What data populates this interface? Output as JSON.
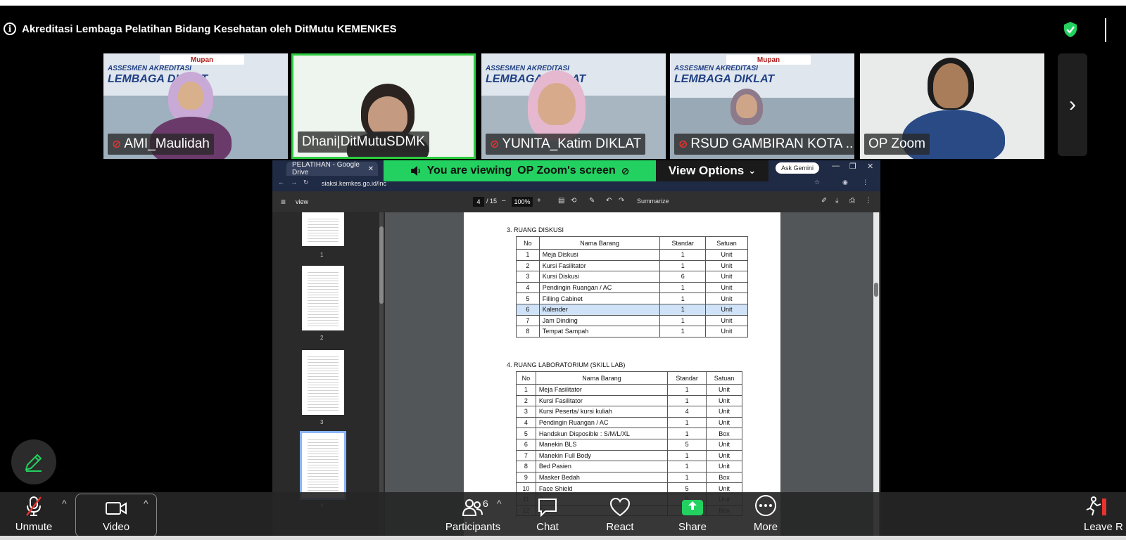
{
  "meeting": {
    "title": "Akreditasi Lembaga Pelatihan Bidang Kesehatan oleh DitMutu KEMENKES"
  },
  "participants_strip": [
    {
      "name": "AMI_Maulidah",
      "muted": true
    },
    {
      "name": "Dhani|DitMutuSDMK",
      "muted": false,
      "active": true
    },
    {
      "name": "YUNITA_Katim DIKLAT",
      "muted": true
    },
    {
      "name": "RSUD GAMBIRAN KOTA ...",
      "muted": true
    },
    {
      "name": "OP Zoom",
      "muted": false
    }
  ],
  "banner": {
    "line1": "ASSESMEN AKREDITASI",
    "line2": "LEMBAGA DIKLAT",
    "brand": "Mupan"
  },
  "share": {
    "viewing_prefix": "You are viewing",
    "viewing_name": "OP Zoom's screen",
    "view_options": "View Options"
  },
  "browser": {
    "tab_title": "PELATIHAN - Google Drive",
    "url": "siaksi.kemkes.go.id/inc",
    "ask_gemini": "Ask Gemini",
    "doc_label": "view",
    "page_current": "4",
    "page_total": "/ 15",
    "zoom": "100%",
    "summarize": "Summarize"
  },
  "thumbnails": [
    {
      "label": "1"
    },
    {
      "label": "2"
    },
    {
      "label": "3"
    },
    {
      "label": "4",
      "selected": true
    }
  ],
  "document": {
    "section3": {
      "title": "3.  RUANG DISKUSI",
      "headers": [
        "No",
        "Nama Barang",
        "Standar",
        "Satuan"
      ],
      "rows": [
        [
          "1",
          "Meja Diskusi",
          "1",
          "Unit"
        ],
        [
          "2",
          "Kursi Fasilitator",
          "1",
          "Unit"
        ],
        [
          "3",
          "Kursi Diskusi",
          "6",
          "Unit"
        ],
        [
          "4",
          "Pendingin Ruangan / AC",
          "1",
          "Unit"
        ],
        [
          "5",
          "Filling Cabinet",
          "1",
          "Unit"
        ],
        [
          "6",
          "Kalender",
          "1",
          "Unit"
        ],
        [
          "7",
          "Jam Dinding",
          "1",
          "Unit"
        ],
        [
          "8",
          "Tempat Sampah",
          "1",
          "Unit"
        ]
      ]
    },
    "section4": {
      "title": "4.  RUANG LABORATORIUM (SKILL LAB)",
      "headers": [
        "No",
        "Nama Barang",
        "Standar",
        "Satuan"
      ],
      "rows": [
        [
          "1",
          "Meja Fasilitator",
          "1",
          "Unit"
        ],
        [
          "2",
          "Kursi Fasilitator",
          "1",
          "Unit"
        ],
        [
          "3",
          "Kursi Peserta/ kursi kuliah",
          "4",
          "Unit"
        ],
        [
          "4",
          "Pendingin Ruangan / AC",
          "1",
          "Unit"
        ],
        [
          "5",
          "Handskun Disposible : S/M/L/XL",
          "1",
          "Box"
        ],
        [
          "6",
          "Manekin BLS",
          "5",
          "Unit"
        ],
        [
          "7",
          "Manekin Full Body",
          "1",
          "Unit"
        ],
        [
          "8",
          "Bed Pasien",
          "1",
          "Unit"
        ],
        [
          "9",
          "Masker Bedah",
          "1",
          "Box"
        ],
        [
          "10",
          "Face Shield",
          "5",
          "Unit"
        ],
        [
          "11",
          "Gown",
          "5",
          "Unit"
        ],
        [
          "12",
          "Cap",
          "1",
          "Box"
        ]
      ]
    }
  },
  "toolbar": {
    "unmute": "Unmute",
    "video": "Video",
    "participants": "Participants",
    "participants_count": "6",
    "chat": "Chat",
    "react": "React",
    "share": "Share",
    "more": "More",
    "leave": "Leave R"
  },
  "colors": {
    "share_green": "#23d160",
    "mute_red": "#e8322e",
    "active_border": "#2ecc40"
  }
}
